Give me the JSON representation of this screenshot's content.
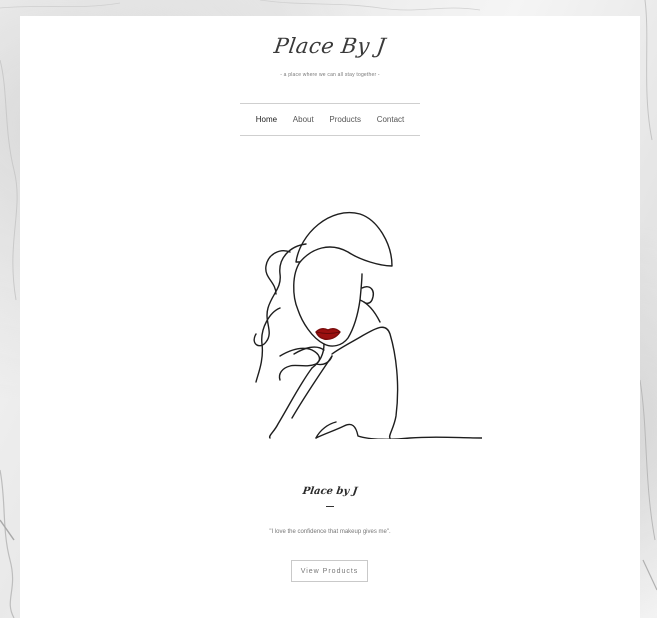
{
  "header": {
    "brand": "Place By J",
    "tagline": "- a place where we can all stay together -"
  },
  "nav": {
    "items": [
      {
        "label": "Home",
        "active": true
      },
      {
        "label": "About",
        "active": false
      },
      {
        "label": "Products",
        "active": false
      },
      {
        "label": "Contact",
        "active": false
      }
    ]
  },
  "hero": {
    "illustration": "line-art-woman-portrait",
    "lip_color": "#9b1010"
  },
  "section": {
    "sub_brand": "Place by J",
    "quote": "\"I love the confidence that makeup gives me\".",
    "cta_label": "View Products"
  },
  "colors": {
    "background": "#f1f1f1",
    "card": "#ffffff",
    "text": "#3a3a3a"
  }
}
